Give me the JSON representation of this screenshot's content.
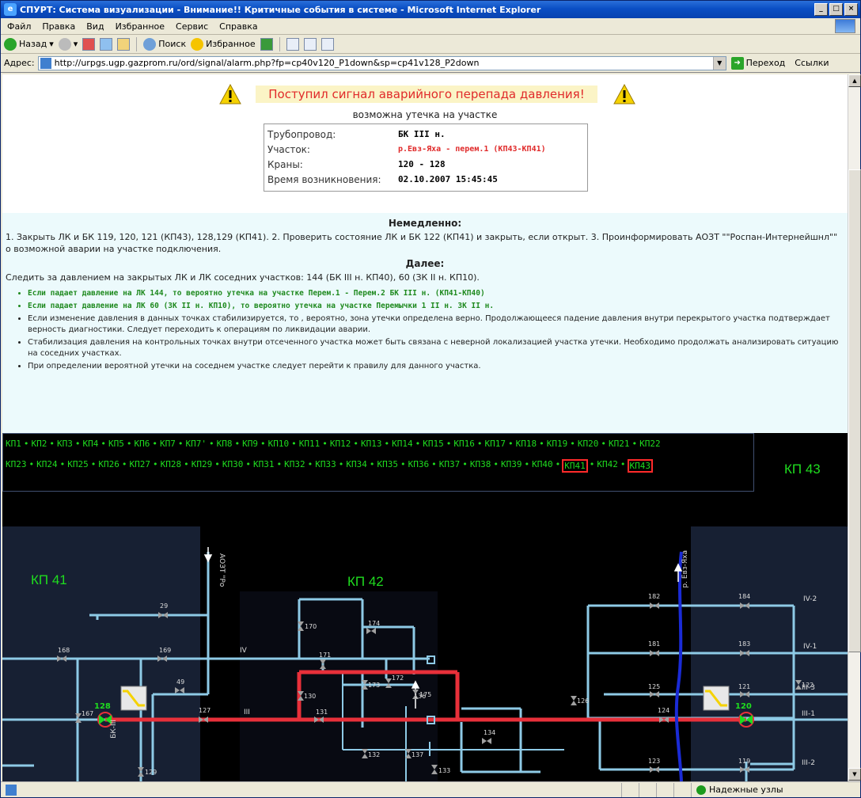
{
  "window": {
    "title": "СПУРТ: Система визуализации - Внимание!! Критичные события в системе - Microsoft Internet Explorer",
    "controls": [
      "_",
      "□",
      "×"
    ]
  },
  "menu": [
    "Файл",
    "Правка",
    "Вид",
    "Избранное",
    "Сервис",
    "Справка"
  ],
  "toolbar": {
    "back": "Назад",
    "search": "Поиск",
    "favorites": "Избранное"
  },
  "address": {
    "label": "Адрес:",
    "url": "http://urpgs.ugp.gazprom.ru/ord/signal/alarm.php?fp=cp40v120_P1down&sp=cp41v128_P2down",
    "go": "Переход",
    "links": "Ссылки"
  },
  "alert": {
    "title": "Поступил сигнал аварийного перепада давления!",
    "subtitle": "возможна утечка на участке",
    "rows": [
      {
        "key": "Трубопровод:",
        "value": "БК III н."
      },
      {
        "key": "Участок:",
        "value": "р.Евз-Яха - перем.1 (КП43-КП41)"
      },
      {
        "key": "Краны:",
        "value": "120 - 128"
      },
      {
        "key": "Время возникновения:",
        "value": "02.10.2007 15:45:45"
      }
    ]
  },
  "instructions": {
    "h_now": "Немедленно:",
    "now_text": "1. Закрыть ЛК и БК 119, 120, 121 (КП43), 128,129 (КП41). 2. Проверить состояние ЛК и БК 122 (КП41) и закрыть, если открыт. 3. Проинформировать АОЗТ \"\"Роспан-Интернейшнл\"\" о возможной аварии на участке подключения.",
    "h_next": "Далее:",
    "next_text": "Следить за давлением на закрытых ЛК и ЛК соседних участков: 144 (БК III н. КП40), 60 (ЗК II н. КП10).",
    "bullets": [
      {
        "text": "Если падает давление на ЛК 144, то вероятно утечка на участке Перем.1 - Перем.2 БК III н. (КП41-КП40)",
        "green": true
      },
      {
        "text": "Если падает давление на ЛК 60 (ЗК II н. КП10), то вероятно утечка на участке Перемычки 1 II н. ЗК II н.",
        "green": true
      },
      {
        "text": "Если изменение давления в данных точках стабилизируется, то , вероятно, зона утечки определена верно. Продолжающееся падение давления внутри перекрытого участка подтверждает верность диагностики. Следует переходить к операциям по ликвидации аварии.",
        "green": false
      },
      {
        "text": "Стабилизация давления на контрольных точках внутри отсеченного участка может быть связана с неверной локализацией участка утечки. Необходимо продолжать анализировать ситуацию на соседних участках.",
        "green": false
      },
      {
        "text": "При определении вероятной утечки на соседнем участке следует перейти к правилу для данного участка.",
        "green": false
      }
    ]
  },
  "kp_nav": {
    "row1": [
      "КП1",
      "КП2",
      "КП3",
      "КП4",
      "КП5",
      "КП6",
      "КП7",
      "КП7'",
      "КП8",
      "КП9",
      "КП10",
      "КП11",
      "КП12",
      "КП13",
      "КП14",
      "КП15",
      "КП16",
      "КП17",
      "КП18",
      "КП19",
      "КП20",
      "КП21",
      "КП22"
    ],
    "row2": [
      "КП23",
      "КП24",
      "КП25",
      "КП26",
      "КП27",
      "КП28",
      "КП29",
      "КП30",
      "КП31",
      "КП32",
      "КП33",
      "КП34",
      "КП35",
      "КП36",
      "КП37",
      "КП38",
      "КП39",
      "КП40",
      "КП41",
      "КП42",
      "КП43"
    ],
    "highlighted": [
      "КП41",
      "КП43"
    ],
    "sep": "•"
  },
  "scheme": {
    "labels": {
      "kp41": "КП 41",
      "kp42": "КП 42",
      "kp43": "КП 43"
    },
    "aozt": "АОЗТ \"Ро",
    "river": "р. Евз-Яха",
    "node_left": "128",
    "node_right": "120",
    "line_labels": [
      "IV-2",
      "IV-1",
      "IV",
      "III",
      "III-3",
      "III-1",
      "III-2",
      "БК-III"
    ],
    "valves": [
      "29",
      "168",
      "169",
      "167",
      "49",
      "127",
      "129",
      "170",
      "174",
      "171",
      "173",
      "172",
      "175",
      "130",
      "131",
      "132",
      "136",
      "137",
      "133",
      "134",
      "182",
      "184",
      "181",
      "183",
      "126",
      "122",
      "125",
      "121",
      "124",
      "123",
      "119"
    ],
    "pipe_color": "#8ecae6",
    "alarm_color": "#e8303a",
    "river_color": "#1a2bd6"
  },
  "status": {
    "zone": "Надежные узлы"
  }
}
